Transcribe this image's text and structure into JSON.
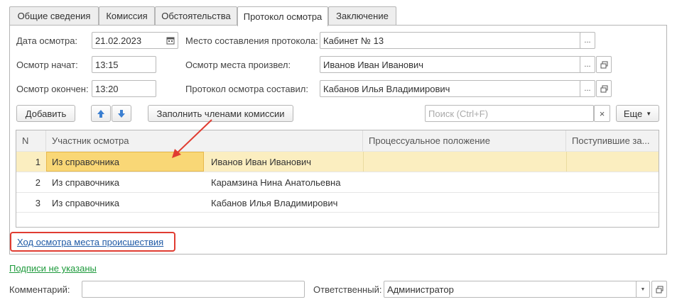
{
  "colors": {
    "selected_row": "#fbeec0",
    "selected_cell": "#f9d776",
    "highlight_red": "#e03c31",
    "link_blue": "#1f5aa6",
    "link_green": "#1e9a3c"
  },
  "tabs": [
    {
      "label": "Общие сведения"
    },
    {
      "label": "Комиссия"
    },
    {
      "label": "Обстоятельства"
    },
    {
      "label": "Протокол осмотра",
      "active": true
    },
    {
      "label": "Заключение"
    }
  ],
  "form": {
    "date_label": "Дата осмотра:",
    "date_value": "21.02.2023",
    "start_label": "Осмотр начат:",
    "start_value": "13:15",
    "end_label": "Осмотр окончен:",
    "end_value": "13:20",
    "place_label": "Место составления протокола:",
    "place_value": "Кабинет № 13",
    "inspector_label": "Осмотр места произвел:",
    "inspector_value": "Иванов Иван Иванович",
    "composer_label": "Протокол осмотра составил:",
    "composer_value": "Кабанов Илья Владимирович"
  },
  "toolbar": {
    "add_label": "Добавить",
    "fill_label": "Заполнить членами комиссии",
    "search_placeholder": "Поиск (Ctrl+F)",
    "more_label": "Еще"
  },
  "table": {
    "columns": [
      "N",
      "Участник осмотра",
      "Процессуальное положение",
      "Поступившие за..."
    ],
    "rows": [
      {
        "n": "1",
        "source": "Из справочника",
        "name": "Иванов Иван Иванович",
        "selected": true
      },
      {
        "n": "2",
        "source": "Из справочника",
        "name": "Карамзина Нина Анатольевна"
      },
      {
        "n": "3",
        "source": "Из справочника",
        "name": "Кабанов Илья Владимирович"
      }
    ]
  },
  "links": {
    "progress": "Ход осмотра места происшествия",
    "signatures": "Подписи не указаны"
  },
  "footer": {
    "comment_label": "Комментарий:",
    "comment_value": "",
    "responsible_label": "Ответственный:",
    "responsible_value": "Администратор"
  },
  "icons": [
    "calendar-icon",
    "ellipsis-icon",
    "open-icon",
    "arrow-up-icon",
    "arrow-down-icon",
    "clear-icon",
    "dropdown-icon"
  ]
}
